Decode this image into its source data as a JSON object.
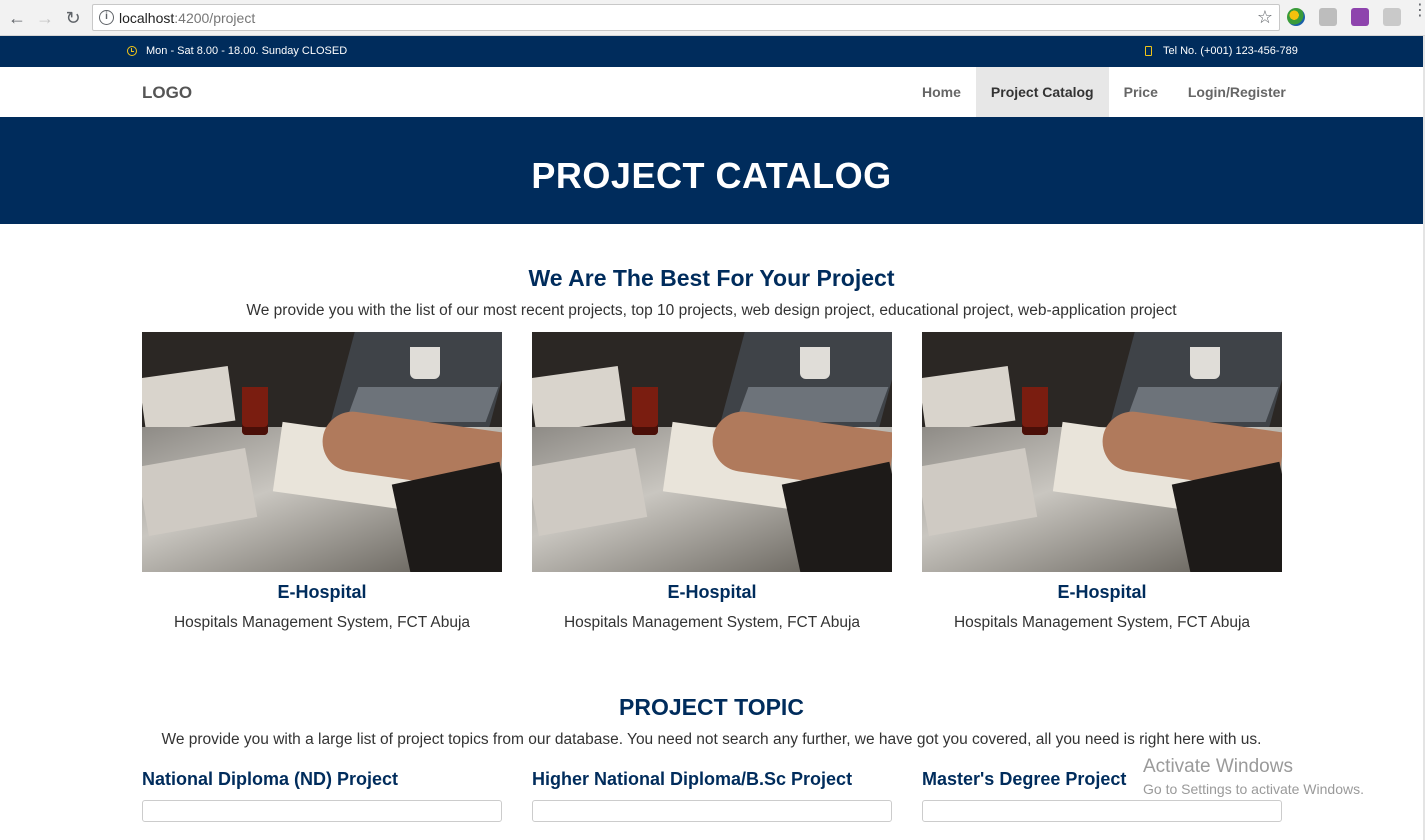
{
  "browser": {
    "url_host": "localhost",
    "url_path": ":4200/project"
  },
  "topbar": {
    "hours": "Mon - Sat 8.00 - 18.00. Sunday CLOSED",
    "phone": "Tel No. (+001) 123-456-789"
  },
  "navbar": {
    "logo": "LOGO",
    "items": [
      {
        "label": "Home"
      },
      {
        "label": "Project Catalog"
      },
      {
        "label": "Price"
      },
      {
        "label": "Login/Register"
      }
    ]
  },
  "hero": {
    "title": "PROJECT CATALOG"
  },
  "intro": {
    "title": "We Are The Best For Your Project",
    "subtitle": "We provide you with the list of our most recent projects, top 10 projects, web design project, educational project, web-application project"
  },
  "projects": [
    {
      "title": "E-Hospital",
      "description": "Hospitals Management System, FCT Abuja"
    },
    {
      "title": "E-Hospital",
      "description": "Hospitals Management System, FCT Abuja"
    },
    {
      "title": "E-Hospital",
      "description": "Hospitals Management System, FCT Abuja"
    }
  ],
  "topics": {
    "title": "PROJECT TOPIC",
    "subtitle": "We provide you with a large list of project topics from our database. You need not search any further, we have got you covered, all you need is right here with us.",
    "columns": [
      {
        "heading": "National Diploma (ND) Project"
      },
      {
        "heading": "Higher National Diploma/B.Sc Project"
      },
      {
        "heading": "Master's Degree Project"
      }
    ]
  },
  "watermark": {
    "line1": "Activate Windows",
    "line2": "Go to Settings to activate Windows."
  }
}
